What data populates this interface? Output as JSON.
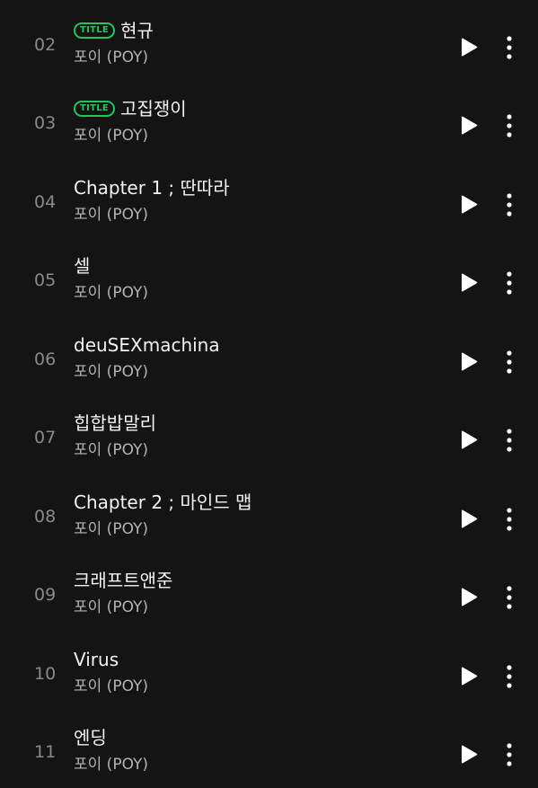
{
  "colors": {
    "background": "#141414",
    "title_badge": "#22c55e",
    "track_title": "#f2f2f2",
    "artist": "#b3b3b3",
    "track_number": "#8a8a8a",
    "icon": "#ffffff"
  },
  "icons": {
    "play": "play-icon",
    "more": "more-vertical-icon"
  },
  "tracks": [
    {
      "number": "02",
      "badge": "TITLE",
      "title": "현규",
      "artist": "포이 (POY)"
    },
    {
      "number": "03",
      "badge": "TITLE",
      "title": "고집쟁이",
      "artist": "포이 (POY)"
    },
    {
      "number": "04",
      "badge": "",
      "title": "Chapter 1 ; 딴따라",
      "artist": "포이 (POY)"
    },
    {
      "number": "05",
      "badge": "",
      "title": "셀",
      "artist": "포이 (POY)"
    },
    {
      "number": "06",
      "badge": "",
      "title": "deuSEXmachina",
      "artist": "포이 (POY)"
    },
    {
      "number": "07",
      "badge": "",
      "title": "힙합밥말리",
      "artist": "포이 (POY)"
    },
    {
      "number": "08",
      "badge": "",
      "title": "Chapter 2 ; 마인드 맵",
      "artist": "포이 (POY)"
    },
    {
      "number": "09",
      "badge": "",
      "title": "크래프트앤준",
      "artist": "포이 (POY)"
    },
    {
      "number": "10",
      "badge": "",
      "title": "Virus",
      "artist": "포이 (POY)"
    },
    {
      "number": "11",
      "badge": "",
      "title": "엔딩",
      "artist": "포이 (POY)"
    }
  ]
}
